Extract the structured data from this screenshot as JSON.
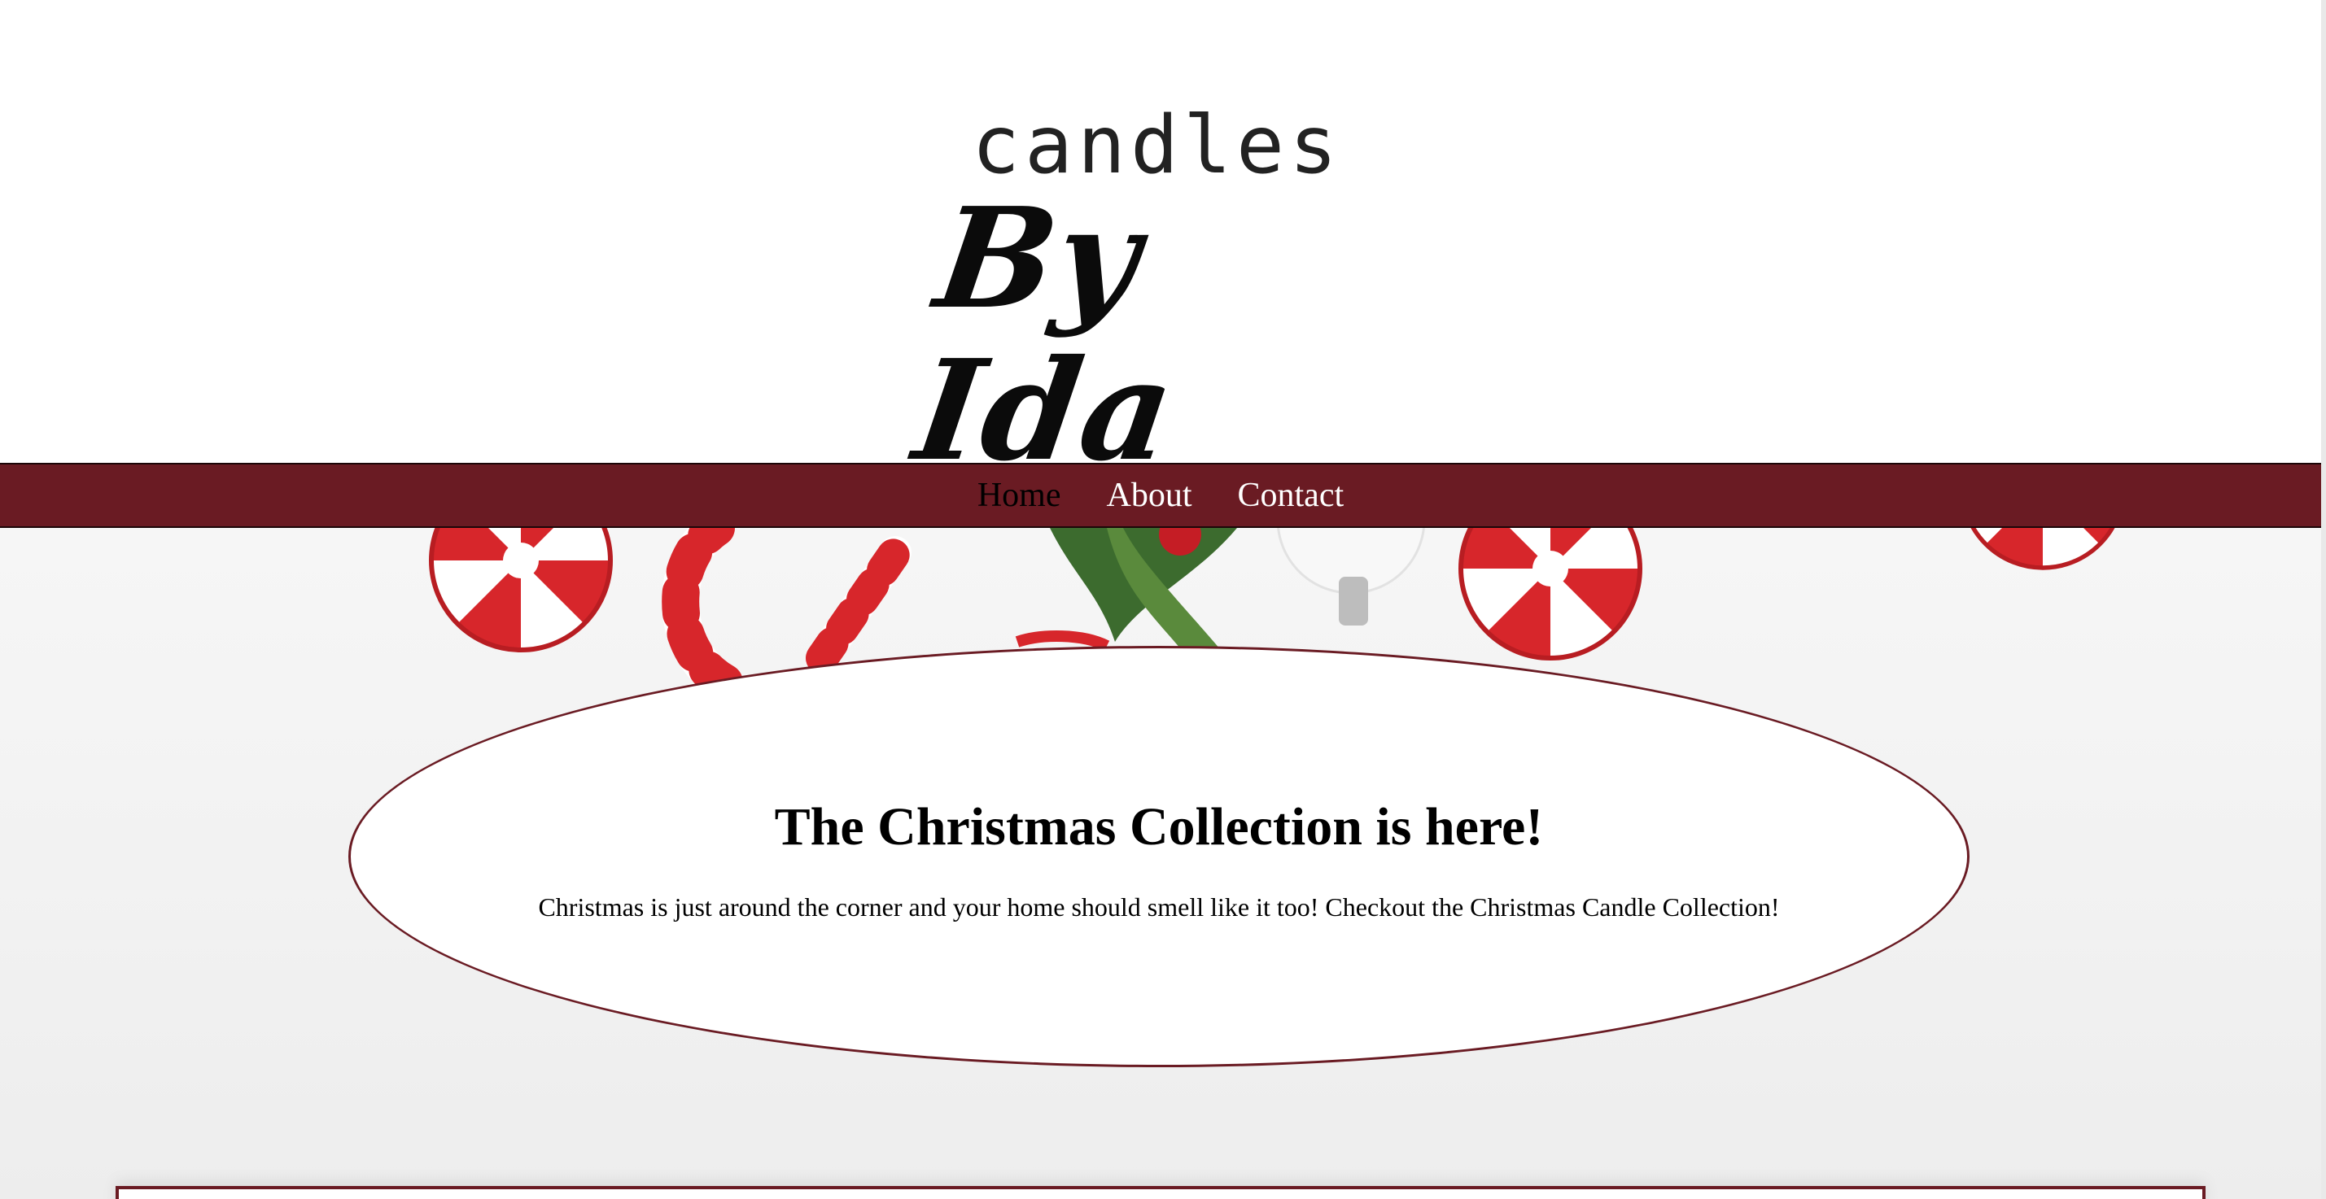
{
  "header": {
    "logo_top": "candles",
    "logo_bottom": "By Ida"
  },
  "nav": {
    "items": [
      {
        "label": "Home",
        "active": true
      },
      {
        "label": "About",
        "active": false
      },
      {
        "label": "Contact",
        "active": false
      }
    ]
  },
  "hero": {
    "title": "The Christmas Collection is here!",
    "text": "Christmas is just around the corner and your home should smell like it too! Checkout the Christmas Candle Collection!"
  },
  "colors": {
    "brand": "#6a1b23",
    "nav_text": "#ffffff",
    "nav_active_text": "#000000",
    "bubble_bg": "#ffffff",
    "candy_red": "#d7262b"
  },
  "icons": [
    "peppermint-candy-icon",
    "candy-cane-icon",
    "holly-leaf-icon",
    "ornament-icon"
  ]
}
